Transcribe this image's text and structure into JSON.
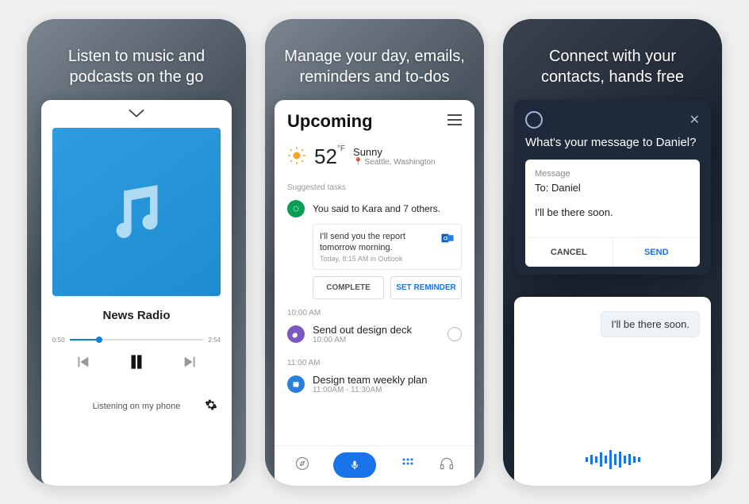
{
  "screen1": {
    "headline": "Listen to music and podcasts on the go",
    "track_title": "News Radio",
    "elapsed": "0:50",
    "total": "2:54",
    "listening_on": "Listening on my phone"
  },
  "screen2": {
    "headline": "Manage your day, emails, reminders and to-dos",
    "title": "Upcoming",
    "weather": {
      "temp": "52",
      "unit": "°F",
      "condition": "Sunny",
      "location": "Seattle, Washington"
    },
    "suggested_label": "Suggested tasks",
    "task1": {
      "header": "You said to Kara and 7 others.",
      "snippet_text": "I'll send you the report tomorrow morning.",
      "snippet_meta": "Today, 8:15 AM in Outlook",
      "complete_label": "COMPLETE",
      "reminder_label": "SET REMINDER"
    },
    "slot1_time": "10:00 AM",
    "slot1": {
      "title": "Send out design deck",
      "sub": "10:00 AM"
    },
    "slot2_time": "11:00 AM",
    "slot2": {
      "title": "Design team weekly plan",
      "sub": "11:00AM - 11:30AM"
    }
  },
  "screen3": {
    "headline": "Connect with your contacts, hands free",
    "prompt": "What's your message to Daniel?",
    "msg_label": "Message",
    "to_prefix": "To:",
    "to_name": "Daniel",
    "body": "I'll be there soon.",
    "cancel_label": "CANCEL",
    "send_label": "SEND",
    "response_bubble": "I'll be there soon."
  }
}
